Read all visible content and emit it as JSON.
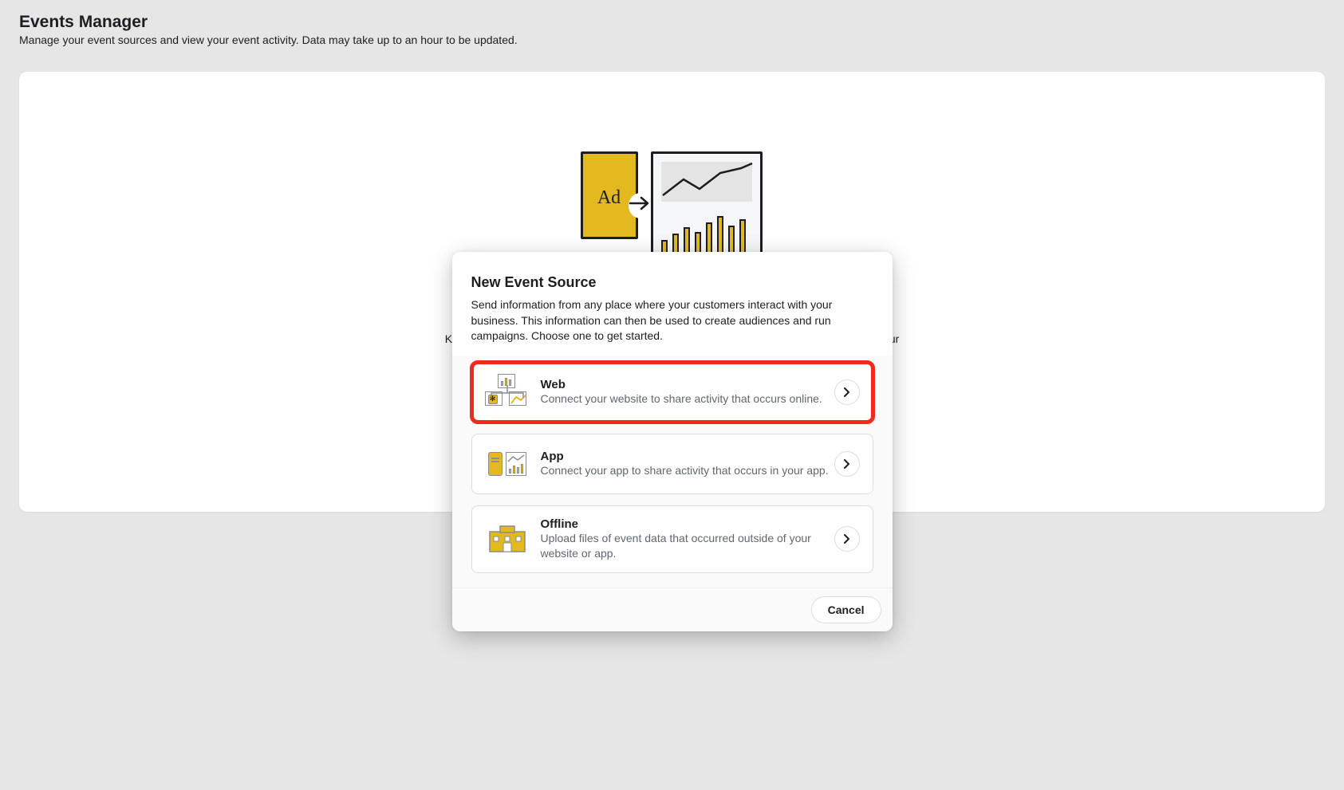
{
  "header": {
    "title": "Events Manager",
    "subtitle": "Manage your event sources and view your event activity. Data may take up to an hour to be updated."
  },
  "hero": {
    "ad_label": "Ad",
    "body_text": "Keep track of the results your ads get by sending information from your website, app or your business's physical shop. To start you need to create at least one ... from ..."
  },
  "modal": {
    "title": "New Event Source",
    "description": "Send information from any place where your customers interact with your business. This information can then be used to create audiences and run campaigns. Choose one to get started.",
    "options": [
      {
        "id": "web",
        "title": "Web",
        "desc": "Connect your website to share activity that occurs online.",
        "highlighted": true
      },
      {
        "id": "app",
        "title": "App",
        "desc": "Connect your app to share activity that occurs in your app.",
        "highlighted": false
      },
      {
        "id": "offline",
        "title": "Offline",
        "desc": "Upload files of event data that occurred outside of your website or app.",
        "highlighted": false
      }
    ],
    "cancel_label": "Cancel"
  }
}
